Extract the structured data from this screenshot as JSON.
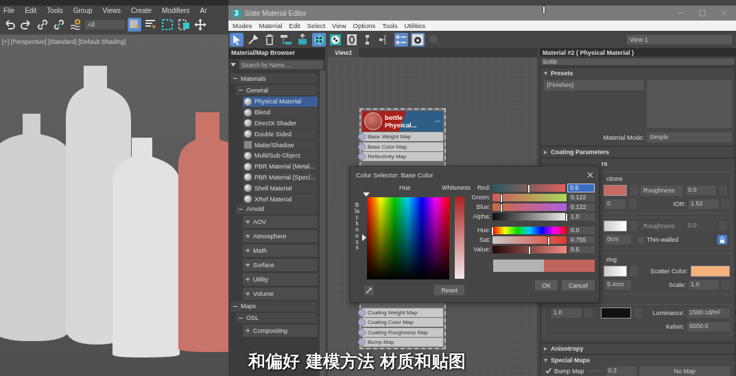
{
  "app_menu": [
    "File",
    "Edit",
    "Tools",
    "Group",
    "Views",
    "Create",
    "Modifiers",
    "Ar"
  ],
  "app_toolbar": {
    "selection_filter": "All"
  },
  "viewport": {
    "label": "[+] [Perspective] [Standard] [Default Shading]"
  },
  "slate": {
    "app_badge": "3",
    "title": "Slate Material Editor",
    "menu": [
      "Modes",
      "Material",
      "Edit",
      "Select",
      "View",
      "Options",
      "Tools",
      "Utilities"
    ],
    "view_dropdown": "View 1"
  },
  "browser": {
    "title": "Material/Map Browser",
    "search": {
      "placeholder": "Search by Name ..."
    },
    "tree": [
      {
        "label": "Materials",
        "expanded": true,
        "children": [
          {
            "label": "General",
            "expanded": true,
            "children": [
              {
                "label": "Physical Material",
                "kind": "material",
                "selected": true
              },
              {
                "label": "Blend",
                "kind": "material",
                "selected": false
              },
              {
                "label": "DirectX Shader",
                "kind": "material",
                "selected": false
              },
              {
                "label": "Double Sided",
                "kind": "material",
                "selected": false
              },
              {
                "label": "Matte/Shadow",
                "kind": "matte",
                "selected": false
              },
              {
                "label": "Multi/Sub-Object",
                "kind": "material",
                "selected": false
              },
              {
                "label": "PBR Material (Metal...",
                "kind": "material",
                "selected": false
              },
              {
                "label": "PBR Material (Spec/...",
                "kind": "material",
                "selected": false
              },
              {
                "label": "Shell Material",
                "kind": "material",
                "selected": false
              },
              {
                "label": "XRef Material",
                "kind": "material",
                "selected": false
              }
            ]
          },
          {
            "label": "Arnold",
            "expanded": true,
            "children": [
              {
                "label": "AOV",
                "kind": "category",
                "expanded": false
              },
              {
                "label": "Atmosphere",
                "kind": "category",
                "expanded": false
              },
              {
                "label": "Math",
                "kind": "category",
                "expanded": false
              },
              {
                "label": "Surface",
                "kind": "category",
                "expanded": false
              },
              {
                "label": "Utility",
                "kind": "category",
                "expanded": false
              },
              {
                "label": "Volume",
                "kind": "category",
                "expanded": false
              }
            ]
          }
        ]
      },
      {
        "label": "Maps",
        "expanded": true,
        "children": [
          {
            "label": "OSL",
            "expanded": true,
            "children": [
              {
                "label": "Compositing",
                "kind": "category",
                "expanded": false
              }
            ]
          }
        ]
      }
    ]
  },
  "view_tab": "View1",
  "node": {
    "title": "bottle",
    "subtitle": "Physical...",
    "slots_top": [
      "Base Weight Map",
      "Base Color Map",
      "Reflectivity Map"
    ],
    "slots_bottom": [
      "Coating Weight Map",
      "Coating Color Map",
      "Coating Roughness Map",
      "Bump Map"
    ]
  },
  "color_selector": {
    "title": "Color Selector: Base Color",
    "hue_label": "Hue",
    "whiteness_label": "Whiteness",
    "blackness_label": "Blackness",
    "channels": [
      {
        "label": "Red:",
        "kind": "red",
        "level": 0.5,
        "value": "0.5",
        "selected": true
      },
      {
        "label": "Green:",
        "kind": "green",
        "level": 0.122,
        "value": "0.122",
        "selected": false
      },
      {
        "label": "Blue:",
        "kind": "blue",
        "level": 0.122,
        "value": "0.122",
        "selected": false
      },
      {
        "label": "Alpha:",
        "kind": "alpha",
        "level": 1.0,
        "value": "1.0",
        "selected": false
      },
      {
        "label": "Hue:",
        "kind": "hue",
        "level": 0.0,
        "value": "0.0",
        "selected": false
      },
      {
        "label": "Sat:",
        "kind": "sat",
        "level": 0.755,
        "value": "0.755",
        "selected": false
      },
      {
        "label": "Value:",
        "kind": "value",
        "level": 0.5,
        "value": "0.5",
        "selected": false
      }
    ],
    "buttons": {
      "reset": "Reset",
      "ok": "OK",
      "cancel": "Cancel"
    }
  },
  "editor": {
    "title": "Material #2  ( Physical Material )",
    "name": "bottle",
    "presets": {
      "label": "Presets",
      "expanded": true,
      "dropdown": "{Finishes}",
      "mode_label": "Material Mode:",
      "mode": "Simple"
    },
    "coating": {
      "label": "Coating Parameters",
      "expanded": false
    },
    "basic": {
      "header_fragment": "rs",
      "group_fragment": "ctions",
      "roughness_mode": "Roughness",
      "roughness": "0.0",
      "ior_fragment": "0",
      "ior_label": "IOR:",
      "ior": "1.52"
    },
    "transparency": {
      "disabled": true,
      "roughness_mode": "Roughness",
      "roughness": "0.0",
      "depth_fragment": "0cm",
      "thin_walled": {
        "label": "Thin-walled",
        "checked": false
      }
    },
    "subsurface": {
      "group_fragment": "ring",
      "scatter_label": "Scatter Color:",
      "radius_fragment": "5.4cm",
      "scale_label": "Scale:",
      "scale": "1.0"
    },
    "emission": {
      "weight": "1.0",
      "luminance_label": "Luminance:",
      "luminance": "1500 cd/m²",
      "kelvin_label": "Kelvin:",
      "kelvin": "6500.0"
    },
    "anisotropy": {
      "label": "Anisotropy",
      "expanded": false
    },
    "special_maps": {
      "label": "Special Maps",
      "expanded": true,
      "bump": {
        "label": "Bump Map",
        "checked": true,
        "amount": "0.3",
        "map": "No Map"
      }
    }
  },
  "subtitle": "和偏好 建模方法 材质和贴图"
}
